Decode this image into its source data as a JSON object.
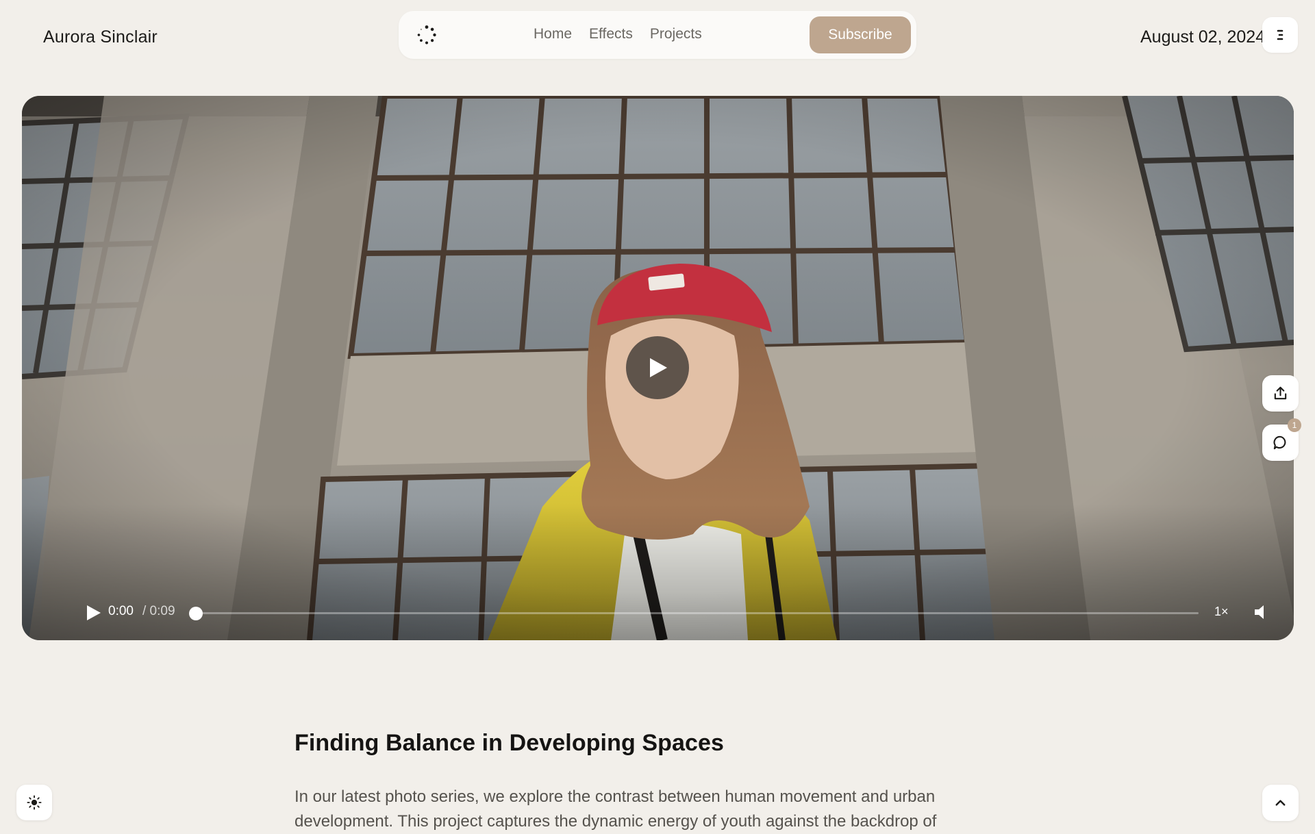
{
  "header": {
    "brand": "Aurora Sinclair",
    "nav": [
      "Home",
      "Effects",
      "Projects"
    ],
    "subscribe_label": "Subscribe",
    "date": "August 02, 2024",
    "logo_icon": "loader-ring-icon",
    "menu_icon": "menu-icon"
  },
  "video": {
    "current_time": "0:00",
    "duration": "/ 0:09",
    "progress": 0,
    "speed": "1×",
    "play_icon": "play-icon",
    "volume_icon": "volume-icon"
  },
  "side_actions": {
    "share_icon": "share-icon",
    "comment_icon": "comment-icon",
    "comment_count": "1"
  },
  "article": {
    "title": "Finding Balance in Developing Spaces",
    "body": "In our latest photo series, we explore the contrast between human movement and urban development. This project captures the dynamic energy of youth against the backdrop of"
  },
  "footer_controls": {
    "theme_icon": "sun-icon",
    "top_icon": "chevron-up-icon"
  },
  "colors": {
    "background": "#f2efea",
    "accent": "#bea68f"
  }
}
